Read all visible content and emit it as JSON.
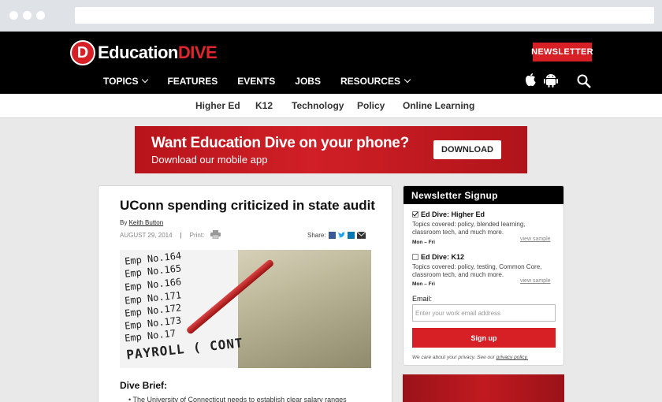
{
  "site": {
    "logo_letter": "D",
    "logo_word": "Education",
    "logo_accent": "DIVE",
    "newsletter_button": "NEWSLETTER",
    "brand_red": "#d71f26"
  },
  "main_nav": [
    {
      "label": "TOPICS",
      "dropdown": true
    },
    {
      "label": "FEATURES",
      "dropdown": false
    },
    {
      "label": "EVENTS",
      "dropdown": false
    },
    {
      "label": "JOBS",
      "dropdown": false
    },
    {
      "label": "RESOURCES",
      "dropdown": true
    }
  ],
  "header_icons": [
    "apple-icon",
    "android-icon",
    "search-icon"
  ],
  "sub_nav": [
    "Higher Ed",
    "K12",
    "Technology",
    "Policy",
    "Online Learning"
  ],
  "banner": {
    "headline": "Want Education Dive on your phone?",
    "subline": "Download our mobile app",
    "button": "DOWNLOAD"
  },
  "article": {
    "title": "UConn spending criticized in state audit",
    "by_prefix": "By",
    "author": "Keith Button",
    "date": "AUGUST 29, 2014",
    "separator": "|",
    "print_label": "Print:",
    "share_label": "Share:",
    "share_icons": [
      "facebook-icon",
      "twitter-icon",
      "linkedin-icon",
      "email-icon"
    ],
    "image_rows": [
      "Emp No.164",
      "Emp No.165",
      "Emp No.166",
      "Emp No.171",
      "Emp No.172",
      "Emp No.173",
      "Emp No.17"
    ],
    "image_caption_text": "PAYROLL ( CONT",
    "brief_heading": "Dive Brief:",
    "first_bullet": "The University of Connecticut needs to establish clear salary ranges"
  },
  "newsletter": {
    "heading": "Newsletter Signup",
    "options": [
      {
        "label": "Ed Dive: Higher Ed",
        "checked": true,
        "desc": "Topics covered: policy, blended learning, classroom tech, and much more.",
        "freq": "Mon – Fri",
        "sample": "view sample"
      },
      {
        "label": "Ed Dive: K12",
        "checked": false,
        "desc": "Topics covered: policy, testing, Common Core, classroom tech, and much more.",
        "freq": "Mon – Fri",
        "sample": "view sample"
      }
    ],
    "email_label": "Email:",
    "email_placeholder": "Enter your work email address",
    "signup_button": "Sign up",
    "privacy_text": "We care about your privacy. See our",
    "privacy_link": "privacy policy."
  }
}
